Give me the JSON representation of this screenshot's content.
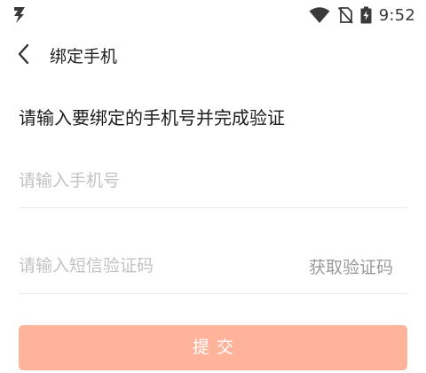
{
  "status_bar": {
    "time": "9:52",
    "icons": [
      "app-logo-icon",
      "wifi-icon",
      "no-sim-icon",
      "battery-charging-icon"
    ]
  },
  "toolbar": {
    "back_icon": "chevron-left-icon",
    "title": "绑定手机"
  },
  "main": {
    "heading": "请输入要绑定的手机号并完成验证",
    "phone_input": {
      "placeholder": "请输入手机号",
      "value": ""
    },
    "code_input": {
      "placeholder": "请输入短信验证码",
      "value": ""
    },
    "get_code_label": "获取验证码",
    "submit_label": "提交"
  },
  "colors": {
    "accent_disabled": "#ffb39b",
    "placeholder": "#c2c2c2",
    "divider": "#e9e9e9"
  }
}
